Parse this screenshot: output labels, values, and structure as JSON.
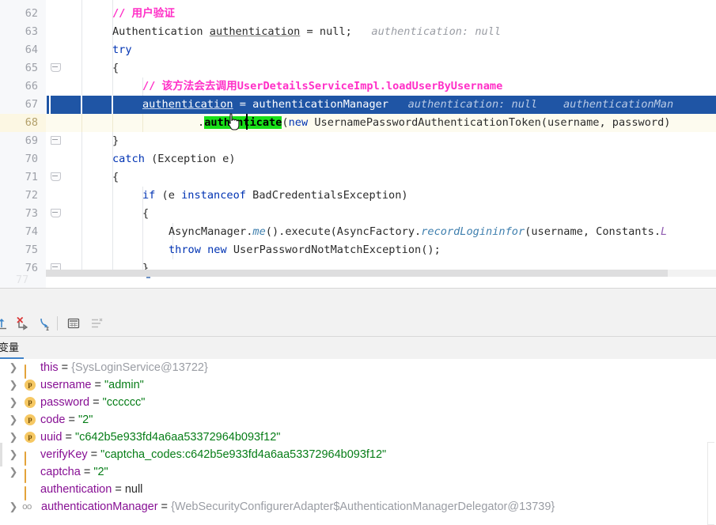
{
  "editor": {
    "language": "java",
    "selection_color": "#1f55a5",
    "caret_line_color": "#fdfbef",
    "comment_color": "#ff2fc7",
    "keyword_color": "#0033b3",
    "string_color": "#067d17",
    "hint_color": "#9a9da4",
    "search_highlight_color": "#18e018",
    "partial_top_glyph": "}",
    "lines": [
      {
        "num": "62",
        "fold": false
      },
      {
        "num": "63",
        "fold": false
      },
      {
        "num": "64",
        "fold": false
      },
      {
        "num": "65",
        "fold": true
      },
      {
        "num": "66",
        "fold": false
      },
      {
        "num": "67",
        "fold": false
      },
      {
        "num": "68",
        "fold": false
      },
      {
        "num": "69",
        "fold": true
      },
      {
        "num": "70",
        "fold": false
      },
      {
        "num": "71",
        "fold": true
      },
      {
        "num": "72",
        "fold": false
      },
      {
        "num": "73",
        "fold": true
      },
      {
        "num": "74",
        "fold": false
      },
      {
        "num": "75",
        "fold": false
      },
      {
        "num": "76",
        "fold": true
      }
    ],
    "code": {
      "l62_comment": "// 用户验证",
      "l63_type": "Authentication",
      "l63_var": "authentication",
      "l63_rest": " = null;",
      "l63_hint": "authentication: null",
      "l64_try": "try",
      "l65_brace": "{",
      "l66_comment": "// 该方法会去调用UserDetailsServiceImpl.loadUserByUsername",
      "l67_var": "authentication",
      "l67_eq": " = authenticationManager",
      "l67_hint1": "authentication: null",
      "l67_hint2": "authenticationMan",
      "l68_dot": ".",
      "l68_method": "authenticate",
      "l68_open": "(",
      "l68_new": "new",
      "l68_token": " UsernamePasswordAuthenticationToken(username, password)",
      "l69_brace": "}",
      "l70_catch": "catch",
      "l70_rest": " (Exception e)",
      "l71_brace": "{",
      "l72_if": "if",
      "l72_a": " (e ",
      "l72_instanceof": "instanceof",
      "l72_b": " BadCredentialsException)",
      "l73_brace": "{",
      "l74_a": "AsyncManager.",
      "l74_me": "me",
      "l74_b": "().execute(AsyncFactory.",
      "l74_record": "recordLogininfor",
      "l74_c": "(username, Constants.",
      "l74_const": "L",
      "l75_throw": "throw",
      "l75_new": " new",
      "l75_rest": " UserPasswordNotMatchException();",
      "l76_brace": "}"
    }
  },
  "debug_toolbar": {
    "buttons": [
      {
        "name": "step-out-icon",
        "title": "Step Out"
      },
      {
        "name": "force-step-into-icon",
        "title": "Force Step Into"
      },
      {
        "name": "smart-step-into-icon",
        "title": "Smart Step Into"
      },
      {
        "name": "evaluate-expression-icon",
        "title": "Evaluate Expression"
      },
      {
        "name": "layout-settings-icon",
        "title": "Layout Settings"
      }
    ]
  },
  "variables_panel": {
    "tab_label": "变量",
    "tab_accent": "#4083c9",
    "rows": [
      {
        "expandable": true,
        "icon": "local",
        "name": "this",
        "value": "{SysLoginService@13722}",
        "value_kind": "ref"
      },
      {
        "expandable": true,
        "icon": "param",
        "name": "username",
        "value": "\"admin\"",
        "value_kind": "string"
      },
      {
        "expandable": true,
        "icon": "param",
        "name": "password",
        "value": "\"cccccc\"",
        "value_kind": "string"
      },
      {
        "expandable": true,
        "icon": "param",
        "name": "code",
        "value": "\"2\"",
        "value_kind": "string"
      },
      {
        "expandable": true,
        "icon": "param",
        "name": "uuid",
        "value": "\"c642b5e933fd4a6aa53372964b093f12\"",
        "value_kind": "string"
      },
      {
        "expandable": true,
        "icon": "local",
        "name": "verifyKey",
        "value": "\"captcha_codes:c642b5e933fd4a6aa53372964b093f12\"",
        "value_kind": "string"
      },
      {
        "expandable": true,
        "icon": "local",
        "name": "captcha",
        "value": "\"2\"",
        "value_kind": "string"
      },
      {
        "expandable": false,
        "icon": "local",
        "name": "authentication",
        "value": "null",
        "value_kind": "null"
      },
      {
        "expandable": true,
        "icon": "field",
        "name": "authenticationManager",
        "value": "{WebSecurityConfigurerAdapter$AuthenticationManagerDelegator@13739}",
        "value_kind": "ref"
      }
    ]
  }
}
